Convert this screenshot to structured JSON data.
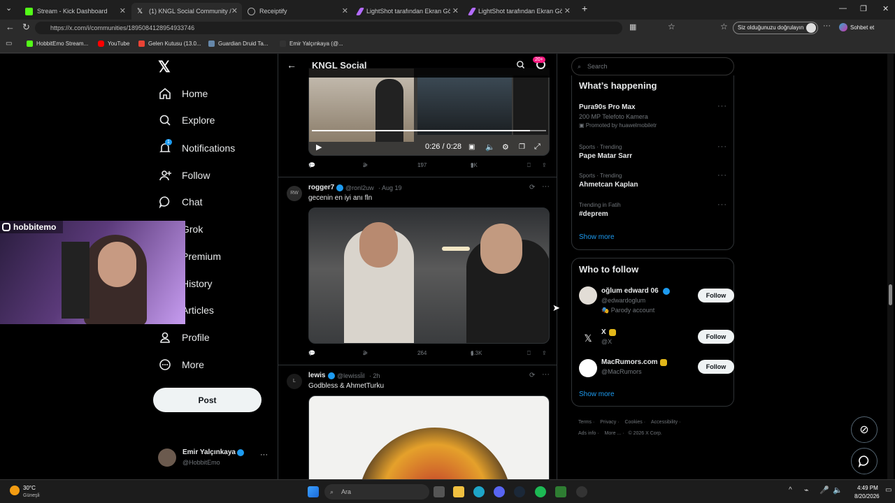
{
  "browser": {
    "tabs": [
      {
        "label": "Stream - Kick Dashboard",
        "color": "#53fc18"
      },
      {
        "label": "(1) KNGL Social Community /",
        "color": "#ffffff"
      },
      {
        "label": "Receiptify",
        "color": "#aaaaaa"
      },
      {
        "label": "LightShot tarafından Ekran Görün",
        "color": "#b36bff"
      },
      {
        "label": "LightShot tarafından Ekran Görün",
        "color": "#b36bff"
      }
    ],
    "url": "https://x.com/i/communities/1895084128954933746",
    "verify_label": "Siz olduğunuzu doğrulayın",
    "copilot_label": "Sohbet et",
    "bookmarks": [
      "HobbitEmo Stream...",
      "YouTube",
      "Gelen Kutusu (13.0...",
      "Guardian Druid Ta...",
      "Emir Yalçınkaya (@..."
    ]
  },
  "sidebar": {
    "items": [
      {
        "label": "Home",
        "icon": "home-icon"
      },
      {
        "label": "Explore",
        "icon": "search-icon"
      },
      {
        "label": "Notifications",
        "icon": "bell-icon",
        "badge": "1"
      },
      {
        "label": "Follow",
        "icon": "add-user-icon"
      },
      {
        "label": "Chat",
        "icon": "chat-icon"
      },
      {
        "label": "Grok",
        "icon": "grok-icon"
      },
      {
        "label": "Premium",
        "icon": "x-icon"
      },
      {
        "label": "History",
        "icon": "history-icon"
      },
      {
        "label": "Articles",
        "icon": "articles-icon"
      },
      {
        "label": "Profile",
        "icon": "profile-icon"
      },
      {
        "label": "More",
        "icon": "more-icon"
      }
    ],
    "post_label": "Post",
    "account": {
      "name": "Emir Yalçınkaya",
      "handle": "@HobbitEmo"
    }
  },
  "webcam": {
    "label": "hobbitemo"
  },
  "feed": {
    "title": "KNGL Social",
    "settings_badge": "20+",
    "video": {
      "time": "0:26 / 0:28",
      "progress": 0.93
    },
    "tweets": [
      {
        "stats": {
          "replies": "1",
          "reposts": "3",
          "likes": "197",
          "views": "9K"
        }
      },
      {
        "name": "rogger7",
        "handle": "@ronl2uw",
        "time": "· Aug 19",
        "text": "gecenin en iyi anı fln",
        "stats": {
          "replies": "1",
          "reposts": "3",
          "likes": "264",
          "views": "6.3K"
        }
      },
      {
        "name": "lewis",
        "handle": "@lewissl̈il",
        "time": "· 2h",
        "text": "Godbless & AhmetTurku"
      }
    ]
  },
  "right": {
    "search_placeholder": "Search",
    "happening_title": "What’s happening",
    "trends": [
      {
        "meta": "",
        "name": "Pura90s Pro Max",
        "desc": "200 MP Telefoto Kamera",
        "promo": "Promoted by huawelmobiletr"
      },
      {
        "meta": "Sports · Trending",
        "name": "Pape Matar Sarr"
      },
      {
        "meta": "Sports · Trending",
        "name": "Ahmetcan Kaplan"
      },
      {
        "meta": "Trending in Fatih",
        "name": "#deprem"
      }
    ],
    "show_more": "Show more",
    "who_title": "Who to follow",
    "follow_suggestions": [
      {
        "name": "oğlum edward 06",
        "handle": "@edwardoglum",
        "note": "Parody account"
      },
      {
        "name": "X",
        "handle": "@X"
      },
      {
        "name": "MacRumors.com",
        "handle": "@MacRumors"
      }
    ],
    "follow_label": "Follow",
    "footer": [
      "Terms",
      "Privacy",
      "Cookies",
      "Accessibility",
      "Ads info",
      "More ...",
      "© 2026 X Corp."
    ]
  },
  "taskbar": {
    "weather": "30°C",
    "weather_sub": "Güneşli",
    "search_placeholder": "Ara",
    "time": "4:49 PM",
    "date": "8/20/2026"
  }
}
